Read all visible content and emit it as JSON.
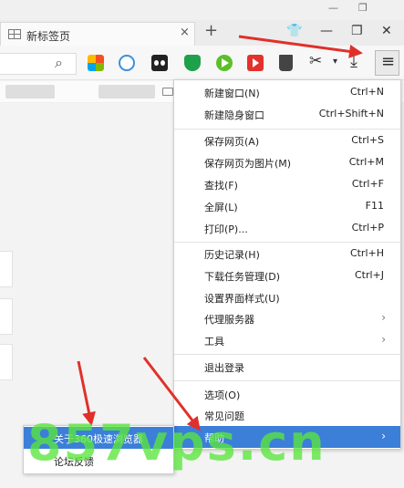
{
  "tab": {
    "title": "新标签页",
    "close_glyph": "×"
  },
  "window_controls": {
    "newtab_glyph": "+",
    "skin_glyph": "👕",
    "minimize_glyph": "—",
    "restore_glyph": "❐",
    "close_glyph": "✕",
    "top_minimize_glyph": "—",
    "top_restore_glyph": "❐"
  },
  "toolbar": {
    "search_glyph": "⌕",
    "cut_glyph": "✂",
    "dropdown_glyph": "▾",
    "download_glyph": "⤓",
    "menu_glyph": "≡"
  },
  "menu": {
    "items": [
      {
        "label": "新建窗口(N)",
        "shortcut": "Ctrl+N"
      },
      {
        "label": "新建隐身窗口",
        "shortcut": "Ctrl+Shift+N"
      },
      {
        "label": "保存网页(A)",
        "shortcut": "Ctrl+S"
      },
      {
        "label": "保存网页为图片(M)",
        "shortcut": "Ctrl+M"
      },
      {
        "label": "查找(F)",
        "shortcut": "Ctrl+F"
      },
      {
        "label": "全屏(L)",
        "shortcut": "F11"
      },
      {
        "label": "打印(P)...",
        "shortcut": "Ctrl+P"
      },
      {
        "label": "历史记录(H)",
        "shortcut": "Ctrl+H"
      },
      {
        "label": "下载任务管理(D)",
        "shortcut": "Ctrl+J"
      },
      {
        "label": "设置界面样式(U)",
        "shortcut": ""
      },
      {
        "label": "代理服务器",
        "shortcut": ""
      },
      {
        "label": "工具",
        "shortcut": ""
      },
      {
        "label": "退出登录",
        "shortcut": ""
      },
      {
        "label": "选项(O)",
        "shortcut": ""
      },
      {
        "label": "常见问题",
        "shortcut": ""
      },
      {
        "label": "帮助",
        "shortcut": ""
      }
    ],
    "arrow_glyph": "›"
  },
  "submenu": {
    "items": [
      {
        "label": "关于360极速浏览器"
      },
      {
        "label": "论坛反馈"
      }
    ]
  },
  "watermark": {
    "text": "857vps.cn"
  },
  "colors": {
    "menu_highlight": "#3b7fd9",
    "arrow": "#e0302a",
    "watermark": "#5ae63c"
  }
}
